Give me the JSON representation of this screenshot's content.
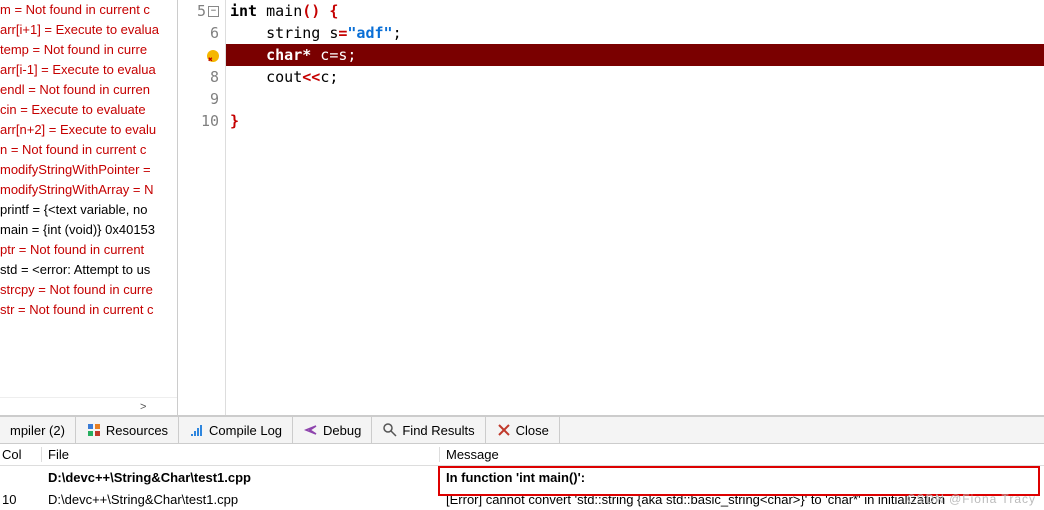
{
  "sidebar": {
    "items": [
      {
        "text": "m = Not found in current c",
        "red": true
      },
      {
        "text": "arr[i+1] = Execute to evalua",
        "red": true
      },
      {
        "text": "temp = Not found in curre",
        "red": true
      },
      {
        "text": "arr[i-1] = Execute to evalua",
        "red": true
      },
      {
        "text": "endl = Not found in curren",
        "red": true
      },
      {
        "text": "cin = Execute to evaluate",
        "red": true
      },
      {
        "text": "arr[n+2] = Execute to evalu",
        "red": true
      },
      {
        "text": "n = Not found in current c",
        "red": true
      },
      {
        "text": "modifyStringWithPointer =",
        "red": true
      },
      {
        "text": "modifyStringWithArray = N",
        "red": true
      },
      {
        "text": "printf = {<text variable, no",
        "red": false
      },
      {
        "text": "main = {int (void)} 0x40153",
        "red": false
      },
      {
        "text": "ptr = Not found in current ",
        "red": true
      },
      {
        "text": "std = <error: Attempt to us",
        "red": false
      },
      {
        "text": "strcpy = Not found in curre",
        "red": true
      },
      {
        "text": "str = Not found in current c",
        "red": true
      }
    ]
  },
  "editor": {
    "lines": [
      {
        "num": "5",
        "fold": true
      },
      {
        "num": "6"
      },
      {
        "num": "",
        "err": true
      },
      {
        "num": "8"
      },
      {
        "num": "9"
      },
      {
        "num": "10"
      }
    ],
    "code": {
      "l5_pre": "",
      "l5_kw": "int",
      "l5_rest": " main",
      "l5_par": "()",
      "l5_brace": " {",
      "l6_indent": "    ",
      "l6_a": "string s",
      "l6_eq": "=",
      "l6_str": "\"adf\"",
      "l6_semi": ";",
      "l7_indent": "    ",
      "l7_kw": "char*",
      "l7_rest": " c=s;",
      "l8_indent": "    ",
      "l8_a": "cout",
      "l8_op": "<<",
      "l8_b": "c",
      "l8_semi": ";",
      "l10_brace": "}"
    }
  },
  "tabs": {
    "compiler": "mpiler (2)",
    "resources": "Resources",
    "compilelog": "Compile Log",
    "debug": "Debug",
    "findresults": "Find Results",
    "close": "Close"
  },
  "table": {
    "headers": {
      "col": "Col",
      "file": "File",
      "msg": "Message"
    },
    "rows": [
      {
        "col": "",
        "file": "D:\\devc++\\String&Char\\test1.cpp",
        "msg": "In function 'int main()':",
        "bold": true
      },
      {
        "col": "10",
        "file": "D:\\devc++\\String&Char\\test1.cpp",
        "msg": "[Error] cannot convert 'std::string {aka std::basic_string<char>}' to 'char*' in initialization",
        "bold": false
      }
    ]
  },
  "watermark": "CSDN @Fiona Tracy"
}
